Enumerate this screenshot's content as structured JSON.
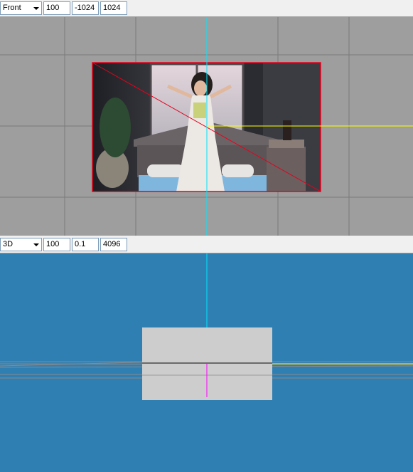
{
  "front_view": {
    "toolbar": {
      "view_mode": "Front",
      "fields": [
        "100",
        "-1024",
        "1024"
      ]
    }
  },
  "view_3d": {
    "toolbar": {
      "view_mode": "3D",
      "fields": [
        "100",
        "0.1",
        "4096"
      ]
    }
  },
  "colors": {
    "front_viewport_bg": "#9e9e9e",
    "viewport_3d_bg": "#2f7fb3",
    "grid": "#7a7a7a",
    "axis_vertical": "#00e5ff",
    "axis_horizontal": "#ffff00",
    "selection": "#e8001c",
    "plane": "#cdcdcd",
    "axis_magenta": "#ff00ff"
  },
  "icons": [
    "dropdown-arrow-icon"
  ]
}
